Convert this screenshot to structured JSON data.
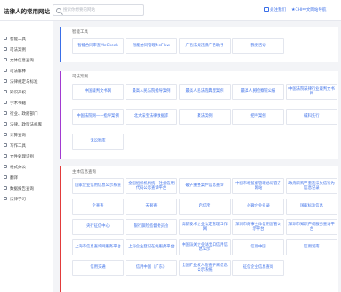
{
  "header": {
    "title": "法律人的常用网站",
    "search_placeholder": "搜索你想要的网站",
    "link_favorite": "关注我们",
    "link_chinese": "CHI中文网站导航"
  },
  "sidebar": {
    "items": [
      {
        "label": "智能工具"
      },
      {
        "label": "司法案例"
      },
      {
        "label": "文体信息查询"
      },
      {
        "label": "司法解释"
      },
      {
        "label": "法律规定与标准"
      },
      {
        "label": "知识产权"
      },
      {
        "label": "学术书籍"
      },
      {
        "label": "行业、政府部门"
      },
      {
        "label": "法律、政策法规库"
      },
      {
        "label": "计算查询"
      },
      {
        "label": "写作工具"
      },
      {
        "label": "文件处理识别"
      },
      {
        "label": "格式办公"
      },
      {
        "label": "翻译"
      },
      {
        "label": "数据报告查询"
      },
      {
        "label": "法律学习"
      }
    ]
  },
  "sections": {
    "smart_tools": {
      "title": "智能工具",
      "cards": [
        "智能合同审查MeCheck",
        "智能合同管理MeFlow",
        "广告法规违禁广告助手",
        "我要咨询"
      ]
    },
    "cases": {
      "title": "司法案例",
      "cards": [
        "中国裁判文书网",
        "最高人民法院指导案例",
        "最高人民法院典型案例",
        "最高人民检察院公报",
        "中国法院法律行业裁判文书网",
        "中国法院网——指导案例",
        "北大法宝法律数据库",
        "聚法案例",
        "把手案例",
        "威科先行",
        "无讼智库"
      ]
    },
    "entity_info": {
      "title": "主体信息查询",
      "cards": [
        "国家企业信用信息公示系统",
        "全国组织机构统一社会信用代码公示查询平台",
        "破产重整案件信息查询",
        "中国市场监督管理总局官方网站",
        "政府采购严重违法失信行为信息记录",
        "企查查",
        "天眼查",
        "启信宝",
        "小微企业名录",
        "国家标准信息",
        "央行征信中心",
        "银行保险监督委员会",
        "高新技术企业认定管理工作网",
        "深圳市商事主体信用监管公示平台",
        "深圳市知识产权服务查询平台",
        "上海市信息查询网服务平台",
        "上海企业登记在线服务平台",
        "中国海关企业进出口信用信息公示",
        "信用中国",
        "信用河南",
        "信用交通",
        "信用中国（广东）",
        "全国矿业权人勘查开采信息公示系统",
        "征信企业信息查询"
      ]
    }
  }
}
